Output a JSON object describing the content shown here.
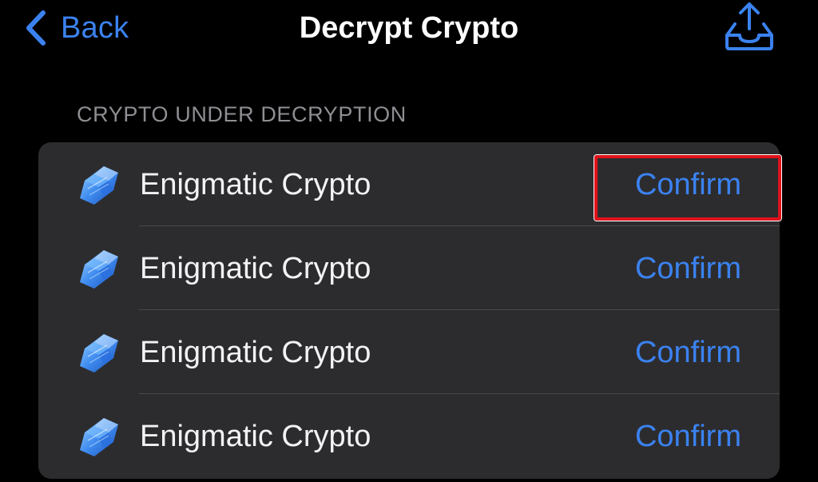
{
  "nav": {
    "back_label": "Back",
    "title": "Decrypt Crypto",
    "share_icon": "share-tray-icon"
  },
  "section": {
    "header": "CRYPTO UNDER DECRYPTION"
  },
  "items": [
    {
      "name": "Enigmatic Crypto",
      "action": "Confirm",
      "icon": "blue-gem-icon"
    },
    {
      "name": "Enigmatic Crypto",
      "action": "Confirm",
      "icon": "blue-gem-icon"
    },
    {
      "name": "Enigmatic Crypto",
      "action": "Confirm",
      "icon": "blue-gem-icon"
    },
    {
      "name": "Enigmatic Crypto",
      "action": "Confirm",
      "icon": "blue-gem-icon"
    }
  ],
  "colors": {
    "background": "#000000",
    "card": "#2c2c2e",
    "accent": "#3b82f0",
    "secondary_text": "#8e8e93",
    "highlight": "#e0121b"
  }
}
